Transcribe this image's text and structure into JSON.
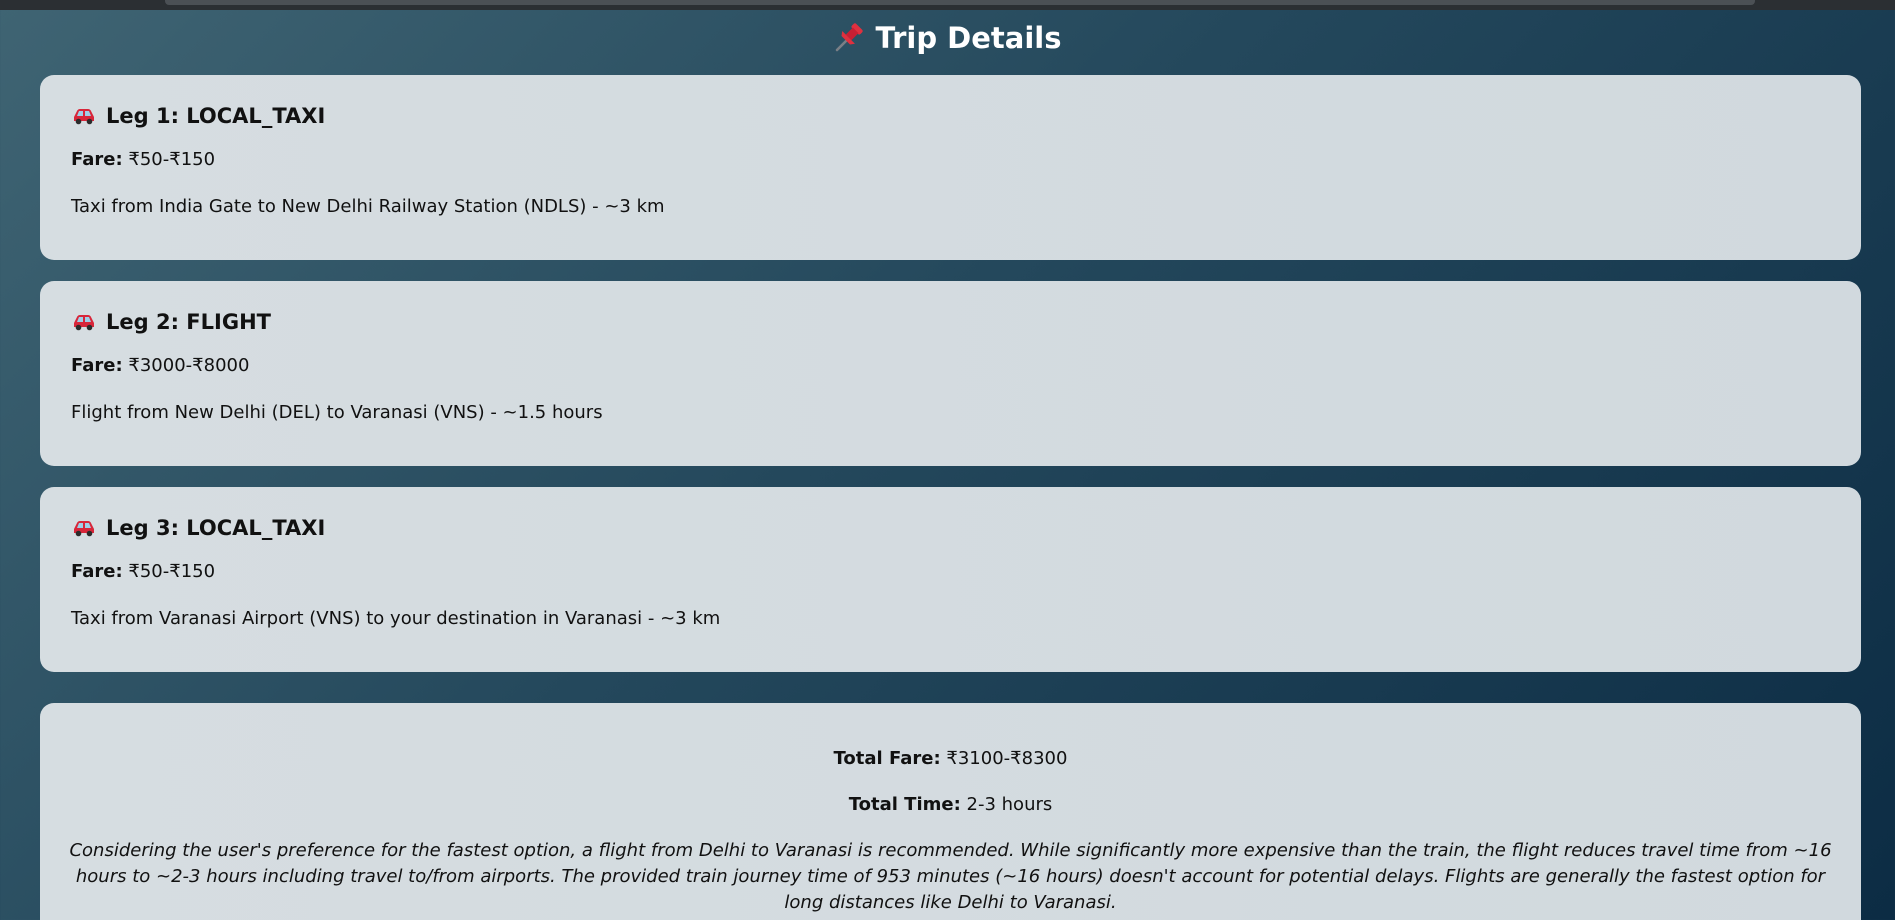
{
  "header": {
    "title": "Trip Details",
    "icon": "pushpin-icon"
  },
  "legs": [
    {
      "title": "Leg 1: LOCAL_TAXI",
      "icon": "car-icon",
      "fare_label": "Fare:",
      "fare_value": "₹50-₹150",
      "description": "Taxi from India Gate to New Delhi Railway Station (NDLS) - ~3 km"
    },
    {
      "title": "Leg 2: FLIGHT",
      "icon": "car-icon",
      "fare_label": "Fare:",
      "fare_value": "₹3000-₹8000",
      "description": "Flight from New Delhi (DEL) to Varanasi (VNS) - ~1.5 hours"
    },
    {
      "title": "Leg 3: LOCAL_TAXI",
      "icon": "car-icon",
      "fare_label": "Fare:",
      "fare_value": "₹50-₹150",
      "description": "Taxi from Varanasi Airport (VNS) to your destination in Varanasi - ~3 km"
    }
  ],
  "summary": {
    "total_fare_label": "Total Fare:",
    "total_fare_value": "₹3100-₹8300",
    "total_time_label": "Total Time:",
    "total_time_value": "2-3 hours",
    "note": "Considering the user's preference for the fastest option, a flight from Delhi to Varanasi is recommended. While significantly more expensive than the train, the flight reduces travel time from ~16 hours to ~2-3 hours including travel to/from airports. The provided train journey time of 953 minutes (~16 hours) doesn't account for potential delays. Flights are generally the fastest option for long distances like Delhi to Varanasi."
  },
  "colors": {
    "background_start": "#3f6473",
    "background_end": "#0c2c44",
    "card": "#d4dbdf",
    "title_text": "#ffffff",
    "pin_red": "#e0303f",
    "car_red": "#d8263a"
  }
}
